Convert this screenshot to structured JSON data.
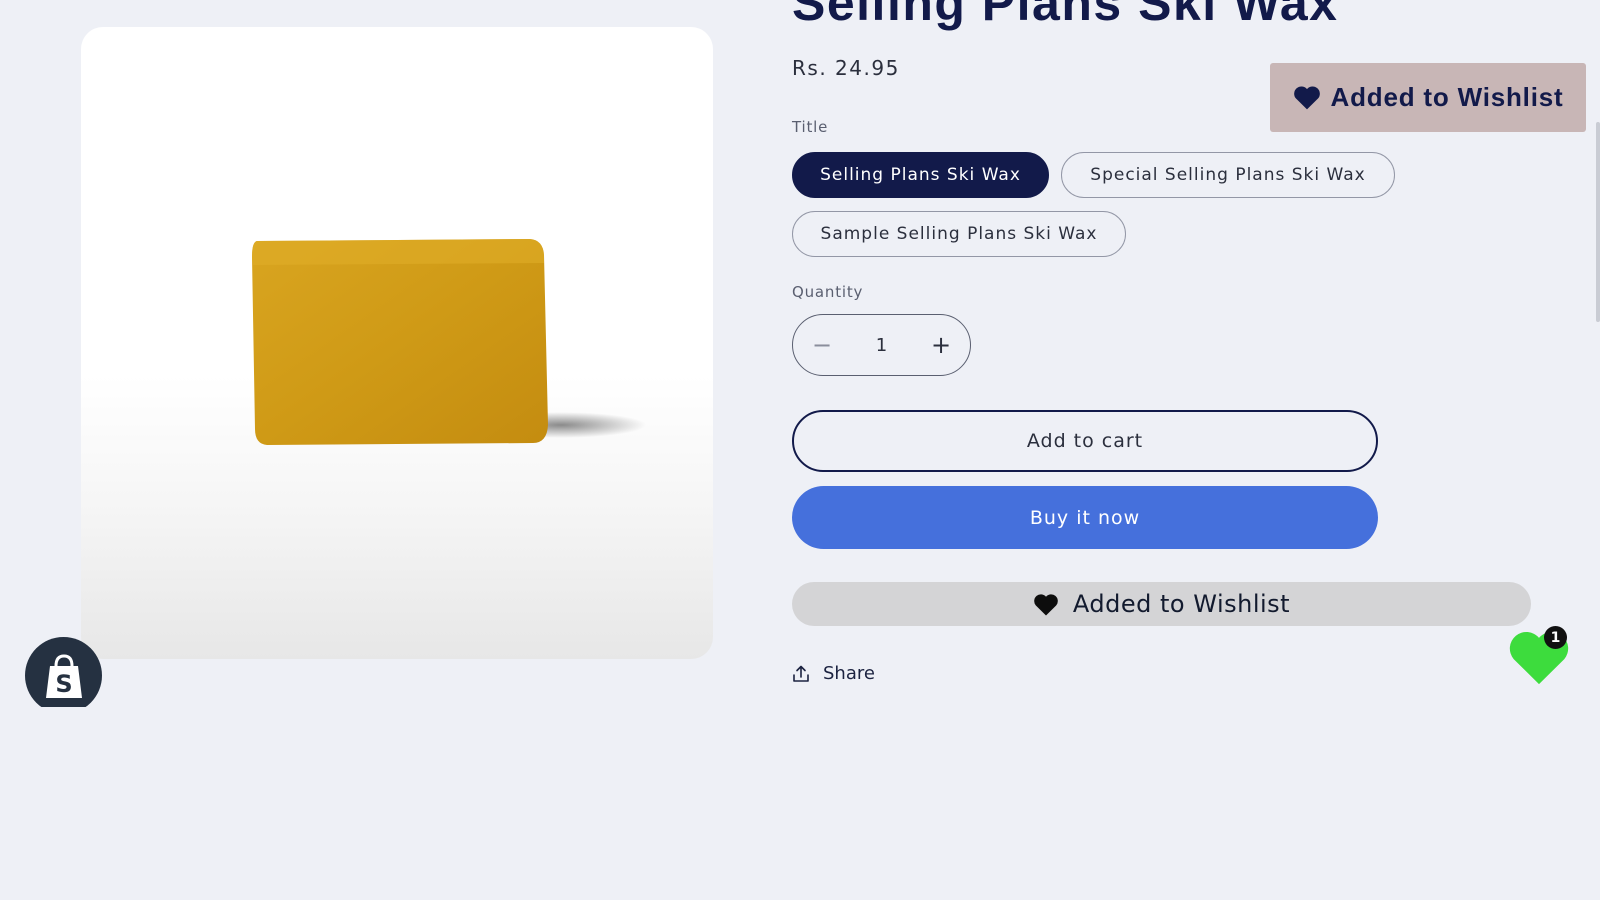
{
  "product": {
    "title": "Selling Plans Ski Wax",
    "price": "Rs. 24.95",
    "image_alt": "yellow ski wax bar"
  },
  "variant": {
    "label": "Title",
    "options": [
      "Selling Plans Ski Wax",
      "Special Selling Plans Ski Wax",
      "Sample Selling Plans Ski Wax"
    ],
    "selected": "Selling Plans Ski Wax"
  },
  "quantity": {
    "label": "Quantity",
    "value": "1",
    "decrease_symbol": "−",
    "increase_symbol": "+"
  },
  "actions": {
    "add_to_cart": "Add to cart",
    "buy_now": "Buy it now",
    "wishlist": "Added to Wishlist",
    "share": "Share"
  },
  "wishlist_header": {
    "label": "Added to Wishlist"
  },
  "wishlist_counter": {
    "count": "1",
    "icon": "heart-icon"
  },
  "colors": {
    "brand_navy": "#121a4a",
    "buy_blue": "#4570dc",
    "wishlist_green": "#3ddc3d",
    "wishlist_header_bg": "#c8b6b6"
  }
}
